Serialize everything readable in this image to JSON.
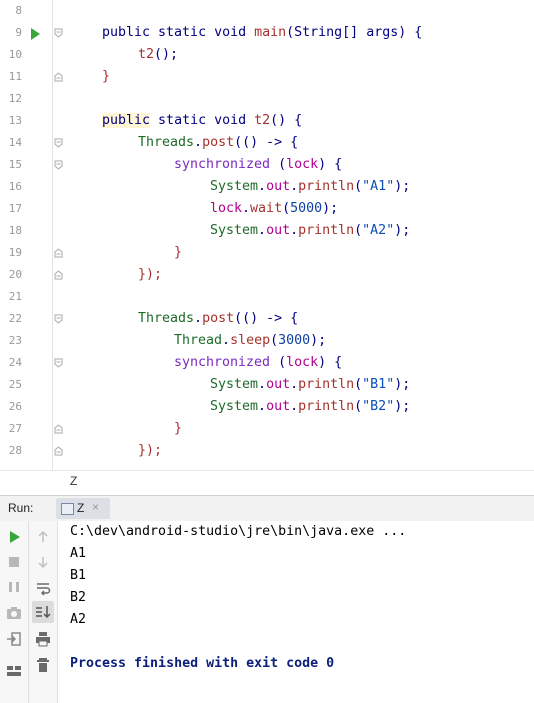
{
  "editor": {
    "lines": [
      {
        "n": "8"
      },
      {
        "n": "9"
      },
      {
        "n": "10"
      },
      {
        "n": "11"
      },
      {
        "n": "12"
      },
      {
        "n": "13"
      },
      {
        "n": "14"
      },
      {
        "n": "15"
      },
      {
        "n": "16"
      },
      {
        "n": "17"
      },
      {
        "n": "18"
      },
      {
        "n": "19"
      },
      {
        "n": "20"
      },
      {
        "n": "21"
      },
      {
        "n": "22"
      },
      {
        "n": "23"
      },
      {
        "n": "24"
      },
      {
        "n": "25"
      },
      {
        "n": "26"
      },
      {
        "n": "27"
      },
      {
        "n": "28"
      }
    ],
    "code": {
      "l9": {
        "kw": "public static void ",
        "fn": "main",
        "rest": "(String[] args) {"
      },
      "l10": {
        "fn": "t2",
        "rest": "();"
      },
      "l11": {
        "rest": "}"
      },
      "l13": {
        "kw1": "public",
        "kw2": " static void ",
        "fn": "t2",
        "rest": "() {"
      },
      "l14": {
        "cls": "Threads",
        "dot": ".",
        "fn": "post",
        "rest": "(() -> {"
      },
      "l15": {
        "sync": "synchronized",
        "open": " (",
        "lck": "lock",
        "close": ") {"
      },
      "l16": {
        "cls": "System",
        "dot": ".",
        "fld": "out",
        "dot2": ".",
        "fn": "println",
        "open": "(",
        "str": "\"A1\"",
        "close": ");"
      },
      "l17": {
        "lck": "lock",
        "dot": ".",
        "fn": "wait",
        "open": "(",
        "num": "5000",
        "close": ");"
      },
      "l18": {
        "cls": "System",
        "dot": ".",
        "fld": "out",
        "dot2": ".",
        "fn": "println",
        "open": "(",
        "str": "\"A2\"",
        "close": ");"
      },
      "l19": {
        "rest": "}"
      },
      "l20": {
        "rest": "});"
      },
      "l22": {
        "cls": "Threads",
        "dot": ".",
        "fn": "post",
        "rest": "(() -> {"
      },
      "l23": {
        "cls": "Thread",
        "dot": ".",
        "fn": "sleep",
        "open": "(",
        "num": "3000",
        "close": ");"
      },
      "l24": {
        "sync": "synchronized",
        "open": " (",
        "lck": "lock",
        "close": ") {"
      },
      "l25": {
        "cls": "System",
        "dot": ".",
        "fld": "out",
        "dot2": ".",
        "fn": "println",
        "open": "(",
        "str": "\"B1\"",
        "close": ");"
      },
      "l26": {
        "cls": "System",
        "dot": ".",
        "fld": "out",
        "dot2": ".",
        "fn": "println",
        "open": "(",
        "str": "\"B2\"",
        "close": ");"
      },
      "l27": {
        "rest": "}"
      },
      "l28": {
        "rest": "});"
      }
    }
  },
  "breadcrumb": {
    "label": "Z"
  },
  "run_panel": {
    "label": "Run:",
    "tab_name": "Z",
    "tab_close": "×"
  },
  "console": {
    "command": "C:\\dev\\android-studio\\jre\\bin\\java.exe ...",
    "output": [
      "A1",
      "B1",
      "B2",
      "A2"
    ],
    "finished": "Process finished with exit code 0"
  },
  "icons": [
    "run-arrow-icon",
    "fold-icon",
    "rerun-icon",
    "stop-icon",
    "pause-icon",
    "camera-icon",
    "login-icon",
    "layout-icon",
    "up-icon",
    "down-icon",
    "soft-wrap-icon",
    "scroll-end-icon",
    "print-icon",
    "trash-icon"
  ]
}
